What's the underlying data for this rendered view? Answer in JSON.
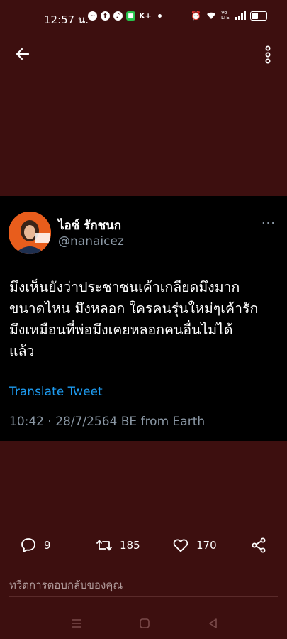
{
  "status_bar": {
    "time": "12:57 น.",
    "kplus": "K+",
    "lte": "Vo LTE"
  },
  "tweet": {
    "display_name": "ไอซ์ รักชนก",
    "handle": "@nanaicez",
    "more": "···",
    "text": "มึงเห็นยังว่าประชาชนเค้าเกลียดมึงมาก\nขนาดไหน มึงหลอก ใครคนรุ่นใหม่ๆเค้ารัก\nมึงเหมือนที่พ่อมึงเคยหลอกคนอื่นไม่ได้\nแล้ว",
    "translate_label": "Translate Tweet",
    "meta": "10:42 · 28/7/2564 BE from Earth"
  },
  "actions": {
    "replies": "9",
    "retweets": "185",
    "likes": "170"
  },
  "reply_placeholder": "ทวีตการตอบกลับของคุณ",
  "colors": {
    "background": "#3d0f0f",
    "card": "#000000",
    "link": "#1d9bf0",
    "muted": "#8b98a5"
  }
}
